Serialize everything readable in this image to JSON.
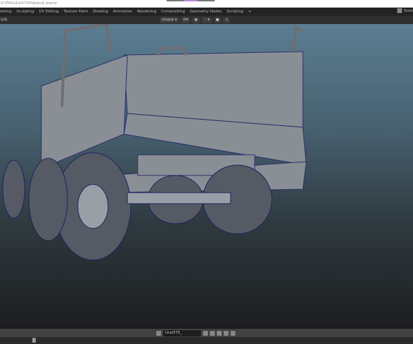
{
  "window": {
    "title": "D:\\File\\Ural375D\\blend\\.blend"
  },
  "workspace_tabs": [
    "deling",
    "Sculpting",
    "UV Editing",
    "Texture Paint",
    "Shading",
    "Animation",
    "Rendering",
    "Compositing",
    "Geometry Nodes",
    "Scripting",
    "+"
  ],
  "top_right": {
    "scene_label": "Scen"
  },
  "header": {
    "mode": "GIS",
    "orientation": "Global"
  },
  "footer": {
    "datablock_name": "Ural375_"
  },
  "colors": {
    "viewport_top": "#5b7e92",
    "viewport_bottom": "#1d1e20",
    "accent": "#b58be0"
  }
}
